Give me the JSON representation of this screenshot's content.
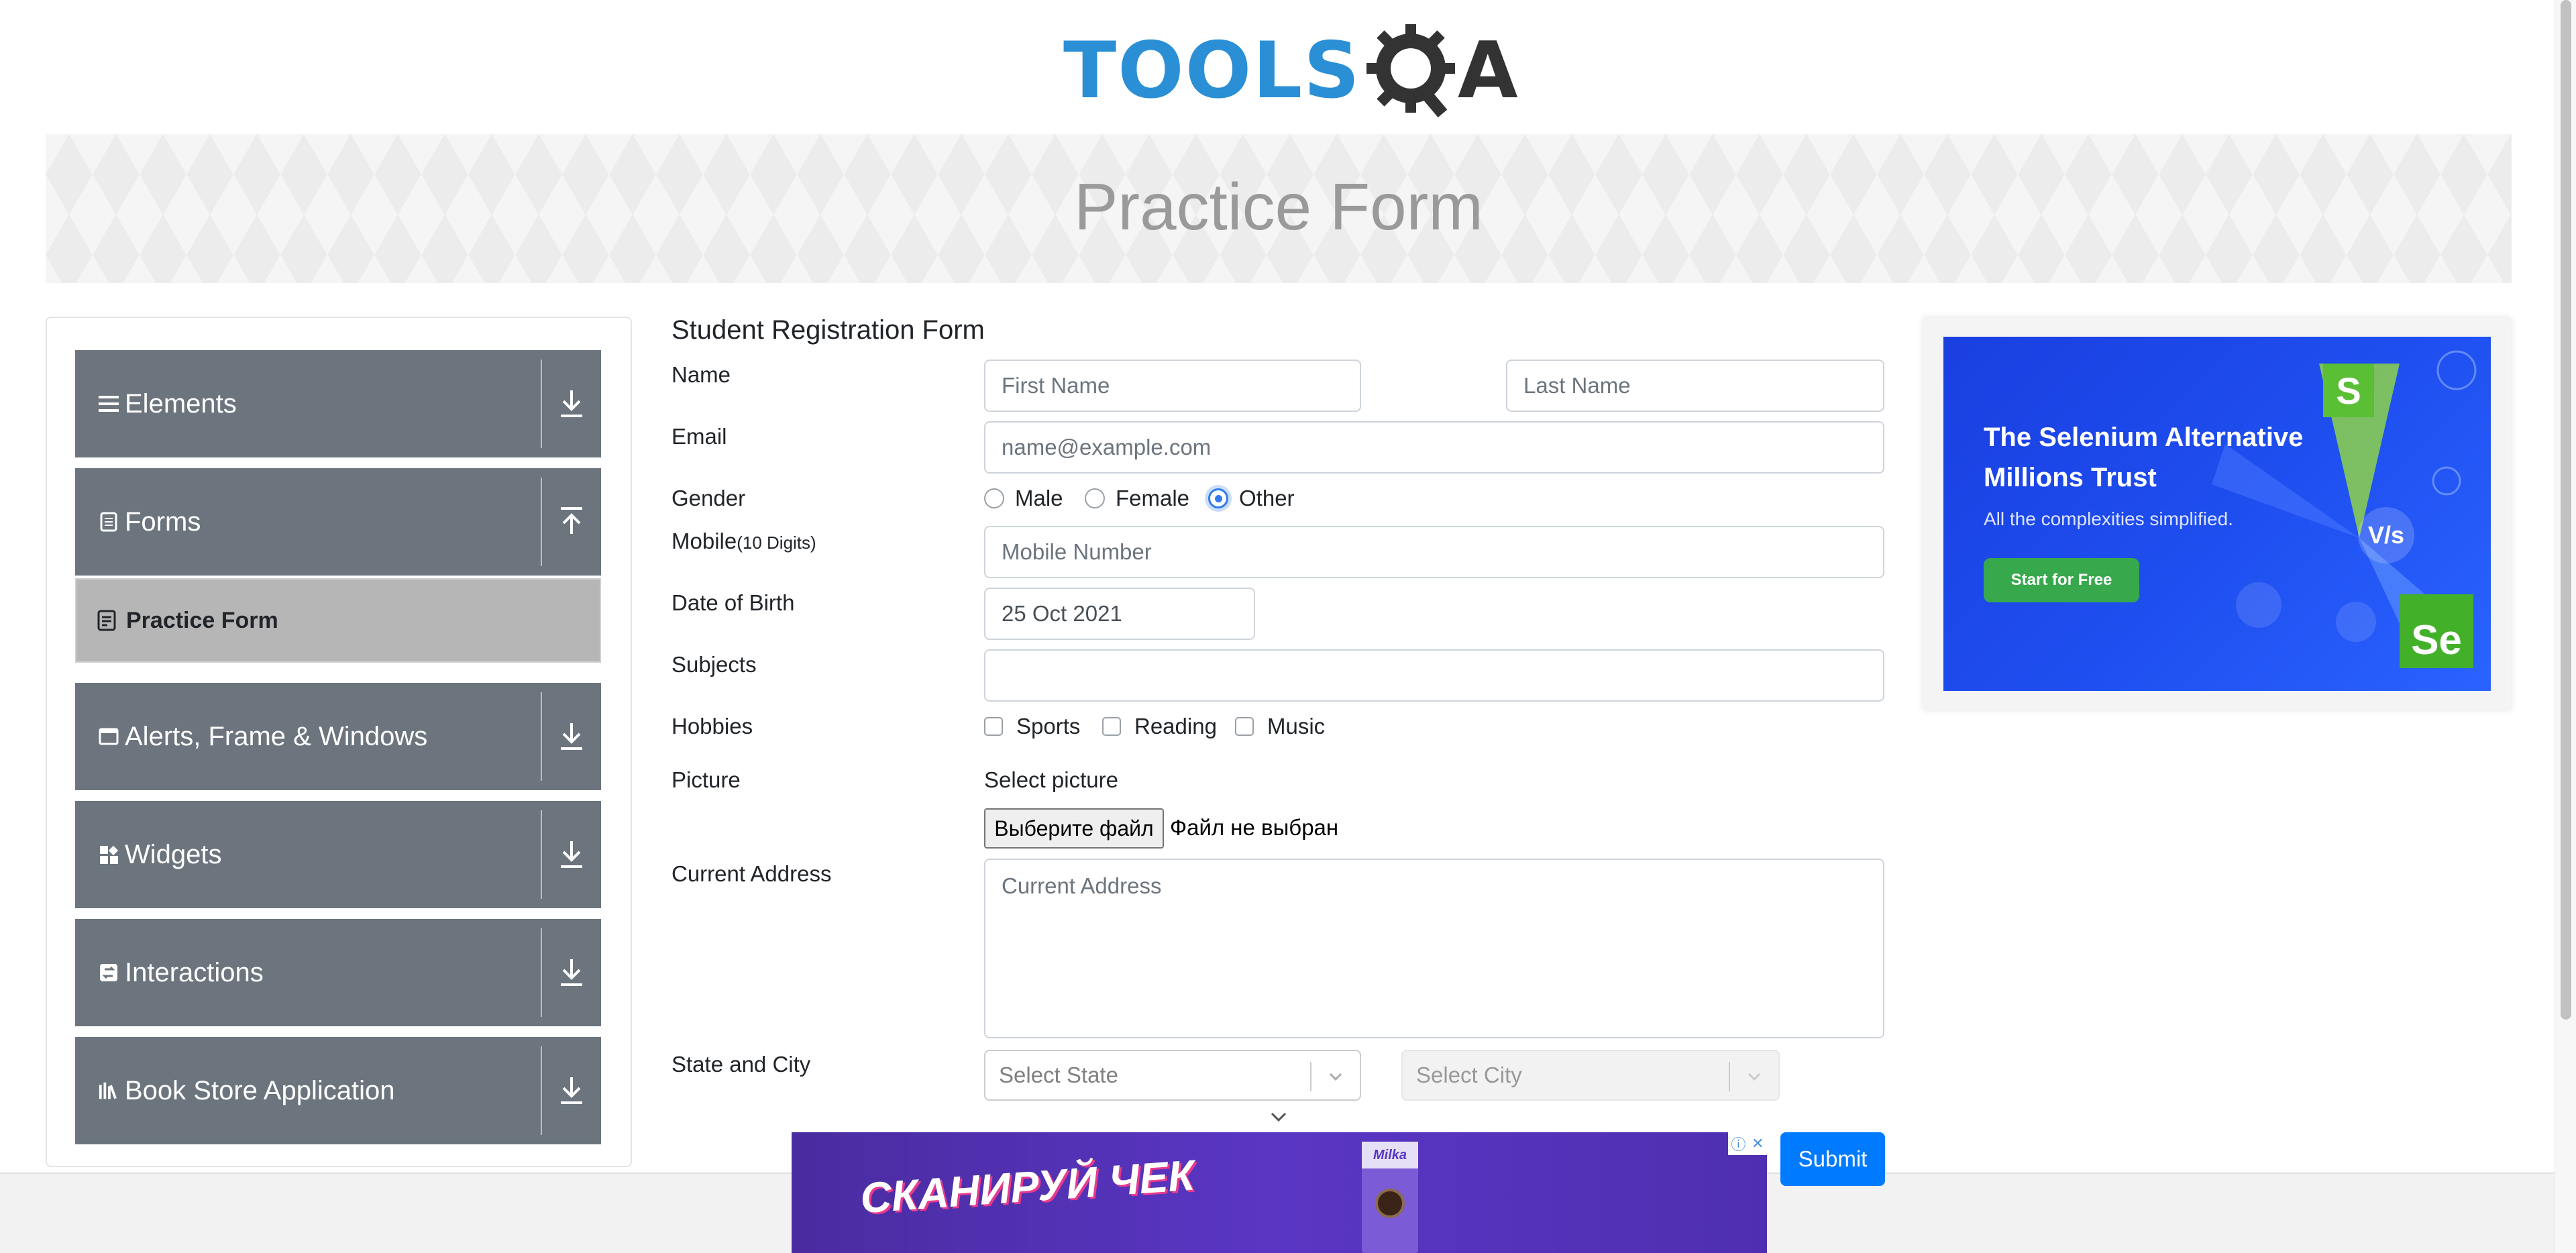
{
  "logo": {
    "tools": "TOOLS",
    "a": "A",
    "alt": "TOOLSQA"
  },
  "banner": {
    "title": "Practice Form"
  },
  "sidebar": {
    "groups": [
      {
        "label": "Elements",
        "icon": "hamburger-icon",
        "arrow": "download-icon"
      },
      {
        "label": "Forms",
        "icon": "document-icon",
        "arrow": "upload-icon"
      },
      {
        "label": "Alerts, Frame & Windows",
        "icon": "window-icon",
        "arrow": "download-icon"
      },
      {
        "label": "Widgets",
        "icon": "widgets-icon",
        "arrow": "download-icon"
      },
      {
        "label": "Interactions",
        "icon": "interactions-icon",
        "arrow": "download-icon"
      },
      {
        "label": "Book Store Application",
        "icon": "books-icon",
        "arrow": "download-icon"
      }
    ],
    "active_item": {
      "label": "Practice Form",
      "icon": "form-icon"
    }
  },
  "form": {
    "title": "Student Registration Form",
    "labels": {
      "name": "Name",
      "email": "Email",
      "gender": "Gender",
      "mobile": "Mobile",
      "mobile_hint": "(10 Digits)",
      "dob": "Date of Birth",
      "subjects": "Subjects",
      "hobbies": "Hobbies",
      "picture": "Picture",
      "address": "Current Address",
      "state_city": "State and City"
    },
    "placeholders": {
      "first_name": "First Name",
      "last_name": "Last Name",
      "email": "name@example.com",
      "mobile": "Mobile Number",
      "address": "Current Address"
    },
    "dob_value": "25 Oct 2021",
    "subjects_value": "",
    "gender_options": [
      "Male",
      "Female",
      "Other"
    ],
    "gender_selected": "Other",
    "hobbies": [
      "Sports",
      "Reading",
      "Music"
    ],
    "picture": {
      "select_label": "Select picture",
      "button": "Выберите файл",
      "status": "Файл не выбран"
    },
    "state_placeholder": "Select State",
    "city_placeholder": "Select City",
    "submit": "Submit"
  },
  "right_ad": {
    "headline_1": "The Selenium Alternative",
    "headline_2": "Millions Trust",
    "sub": "All the complexities simplified.",
    "cta": "Start for Free",
    "badge_s": "S",
    "badge_se": "Se",
    "vs": "V/s"
  },
  "bottom_ad": {
    "text": "СКАНИРУЙ ЧЕК",
    "brand": "Milka"
  },
  "colors": {
    "sidebar_group": "#6c757d",
    "active_item": "#b6b6b6",
    "primary": "#007bff",
    "radio_on": "#2f7bed",
    "logo_blue": "#2b8fd6"
  }
}
